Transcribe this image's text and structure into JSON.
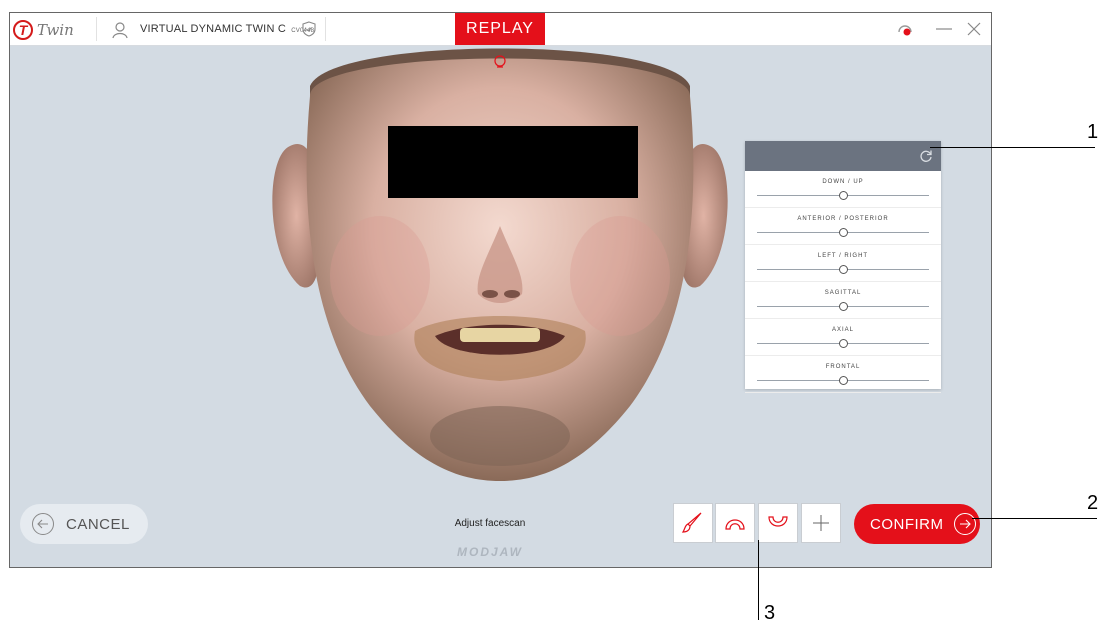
{
  "header": {
    "logo_text": "Twin",
    "logo_letter": "T",
    "patient_name": "VIRTUAL DYNAMIC TWIN C",
    "patient_code": "CV0448",
    "mode_label": "REPLAY"
  },
  "adjust_panel": {
    "sliders": [
      {
        "label": "DOWN / UP",
        "value": 0.5
      },
      {
        "label": "ANTERIOR / POSTERIOR",
        "value": 0.5
      },
      {
        "label": "LEFT / RIGHT",
        "value": 0.5
      },
      {
        "label": "SAGITTAL",
        "value": 0.5
      },
      {
        "label": "AXIAL",
        "value": 0.5
      },
      {
        "label": "FRONTAL",
        "value": 0.5
      }
    ]
  },
  "footer": {
    "cancel_label": "CANCEL",
    "status_text": "Adjust facescan",
    "brand": "MODJAW",
    "confirm_label": "CONFIRM"
  },
  "tools": [
    "brush-icon",
    "upper-arch-icon",
    "lower-arch-icon",
    "crosshair-icon"
  ],
  "callouts": [
    "1",
    "2",
    "3"
  ],
  "colors": {
    "accent": "#e4101a",
    "panel_header": "#6b7380",
    "background": "#d3dbe3"
  }
}
